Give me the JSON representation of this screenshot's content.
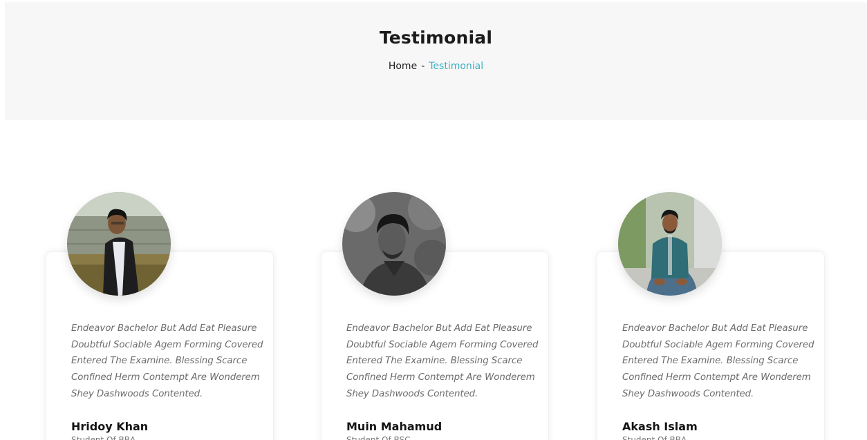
{
  "banner": {
    "title": "Testimonial",
    "breadcrumb": {
      "home": "Home",
      "separator": "-",
      "current": "Testimonial"
    }
  },
  "colors": {
    "accent": "#3ab0c3",
    "banner_bg": "#f7f7f7",
    "quote_text": "#6c6c6c"
  },
  "testimonials": [
    {
      "photo_icon": "person-photo",
      "quote": "Endeavor Bachelor But Add Eat Pleasure Doubtful Sociable Agem Forming Covered Entered The Examine. Blessing Scarce Confined Herm Contempt Are Wonderem Shey Dashwoods Contented.",
      "name": "Hridoy Khan",
      "role": "Student Of BBA"
    },
    {
      "photo_icon": "person-photo",
      "quote": "Endeavor Bachelor But Add Eat Pleasure Doubtful Sociable Agem Forming Covered Entered The Examine. Blessing Scarce Confined Herm Contempt Are Wonderem Shey Dashwoods Contented.",
      "name": "Muin Mahamud",
      "role": "Student Of BSC"
    },
    {
      "photo_icon": "person-photo",
      "quote": "Endeavor Bachelor But Add Eat Pleasure Doubtful Sociable Agem Forming Covered Entered The Examine. Blessing Scarce Confined Herm Contempt Are Wonderem Shey Dashwoods Contented.",
      "name": "Akash Islam",
      "role": "Student Of BBA"
    }
  ]
}
